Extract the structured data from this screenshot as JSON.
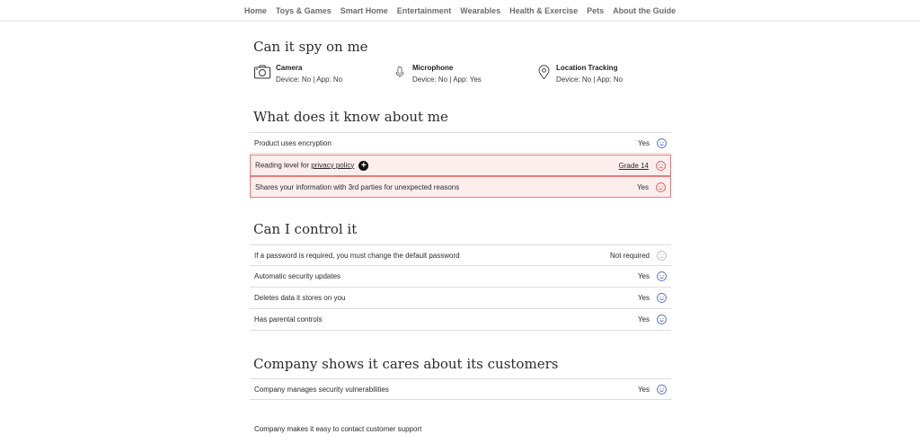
{
  "nav": {
    "items": [
      "Home",
      "Toys & Games",
      "Smart Home",
      "Entertainment",
      "Wearables",
      "Health & Exercise",
      "Pets",
      "About the Guide"
    ]
  },
  "spy": {
    "title": "Can it spy on me",
    "items": [
      {
        "icon": "camera-icon",
        "label": "Camera",
        "value": "Device: No | App: No"
      },
      {
        "icon": "microphone-icon",
        "label": "Microphone",
        "value": "Device: No | App: Yes"
      },
      {
        "icon": "location-pin-icon",
        "label": "Location Tracking",
        "value": "Device: No | App: No"
      }
    ]
  },
  "know": {
    "title": "What does it know about me",
    "rows": [
      {
        "text": "Product uses encryption",
        "answer": "Yes",
        "status": "good"
      },
      {
        "text_prefix": "Reading level for ",
        "text_link": "privacy policy",
        "answer": "Grade 14",
        "status": "bad"
      },
      {
        "text": "Shares your information with 3rd parties for unexpected reasons",
        "answer": "Yes",
        "status": "bad"
      }
    ]
  },
  "control": {
    "title": "Can I control it",
    "rows": [
      {
        "text": "If a password is required, you must change the default password",
        "answer": "Not required",
        "status": "neutral"
      },
      {
        "text": "Automatic security updates",
        "answer": "Yes",
        "status": "good"
      },
      {
        "text": "Deletes data it stores on you",
        "answer": "Yes",
        "status": "good"
      },
      {
        "text": "Has parental controls",
        "answer": "Yes",
        "status": "good"
      }
    ]
  },
  "company": {
    "title": "Company shows it cares about its customers",
    "rows": [
      {
        "text": "Company manages security vulnerabilities",
        "answer": "Yes",
        "status": "good"
      }
    ],
    "footer_text": "Company makes it easy to contact customer support"
  },
  "colors": {
    "good": "#4a5cc4",
    "bad": "#d9534f",
    "neutral": "#b5b5b5",
    "flag_bg": "#fdeeee",
    "flag_border": "#e47b7b"
  }
}
